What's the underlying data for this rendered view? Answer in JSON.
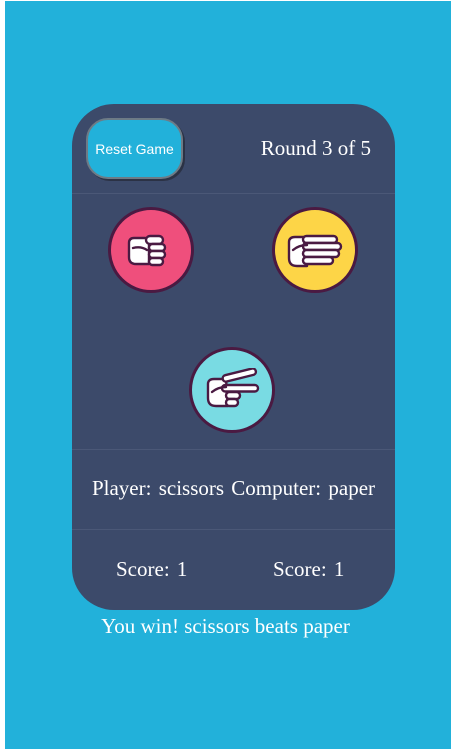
{
  "header": {
    "reset_label": "Reset Game",
    "round_text": "Round 3 of 5"
  },
  "choices": [
    {
      "name": "rock",
      "icon": "fist-hand-icon",
      "color": "#ef4f7c"
    },
    {
      "name": "paper",
      "icon": "flat-hand-icon",
      "color": "#fdd547"
    },
    {
      "name": "scissors",
      "icon": "scissors-hand-icon",
      "color": "#79dbe3"
    }
  ],
  "picks": {
    "player_label": "Player:",
    "player_choice": "scissors",
    "computer_label": "Computer:",
    "computer_choice": "paper"
  },
  "scores": {
    "player_label": "Score:",
    "player_value": "1",
    "computer_label": "Score:",
    "computer_value": "1"
  },
  "result_text": "You win! scissors beats paper",
  "colors": {
    "background": "#22b1da",
    "card": "#3c4a6a",
    "accent": "#22b1da"
  }
}
